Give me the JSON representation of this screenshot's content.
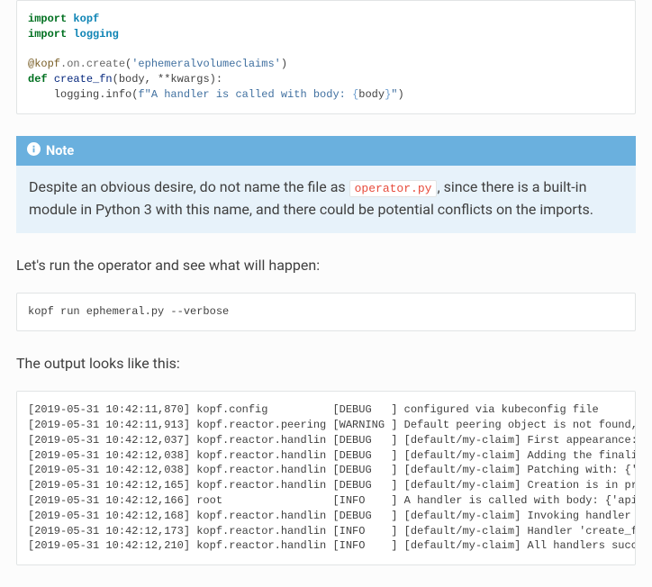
{
  "code": {
    "l1_kw": "import",
    "l1_nn": "kopf",
    "l2_kw": "import",
    "l2_nn": "logging",
    "dec_at": "@kopf",
    "dec_rest": ".on.create",
    "dec_open": "(",
    "dec_str": "'ephemeralvolumeclaims'",
    "dec_close": ")",
    "def_kw": "def",
    "def_sp": " ",
    "def_fn": "create_fn",
    "def_sig": "(body, **kwargs):",
    "body_indent": "    logging.info(",
    "body_fpre": "f\"A handler is called with body: ",
    "body_si_open": "{",
    "body_si_body": "body",
    "body_si_close": "}",
    "body_fpost": "\"",
    "body_end": ")"
  },
  "note": {
    "title": "Note",
    "body_pre": "Despite an obvious desire, do not name the file as ",
    "body_lit": "operator.py",
    "body_post": ", since there is a built-in module in Python 3 with this name, and there could be potential conflicts on the imports."
  },
  "para_run": "Let's run the operator and see what will happen:",
  "cmd": "kopf run ephemeral.py --verbose",
  "para_output": "The output looks like this:",
  "log": {
    "l1": "[2019-05-31 10:42:11,870] kopf.config          [DEBUG   ] configured via kubeconfig file",
    "l2": "[2019-05-31 10:42:11,913] kopf.reactor.peering [WARNING ] Default peering object is not found, falling back to the standalone mode.",
    "l3": "[2019-05-31 10:42:12,037] kopf.reactor.handlin [DEBUG   ] [default/my-claim] First appearance: {'apiVersion': ...",
    "l4": "[2019-05-31 10:42:12,038] kopf.reactor.handlin [DEBUG   ] [default/my-claim] Adding the finalizer, thus preventing the deletion.",
    "l5": "[2019-05-31 10:42:12,038] kopf.reactor.handlin [DEBUG   ] [default/my-claim] Patching with: {'metadata': ...",
    "l6": "[2019-05-31 10:42:12,165] kopf.reactor.handlin [DEBUG   ] [default/my-claim] Creation is in progress: {...",
    "l7": "[2019-05-31 10:42:12,166] root                 [INFO    ] A handler is called with body: {'apiVersion': ...",
    "l8": "[2019-05-31 10:42:12,168] kopf.reactor.handlin [DEBUG   ] [default/my-claim] Invoking handler 'create_fn'.",
    "l9": "[2019-05-31 10:42:12,173] kopf.reactor.handlin [INFO    ] [default/my-claim] Handler 'create_fn' succeeded.",
    "l10": "[2019-05-31 10:42:12,210] kopf.reactor.handlin [INFO    ] [default/my-claim] All handlers succeeded for creation."
  }
}
